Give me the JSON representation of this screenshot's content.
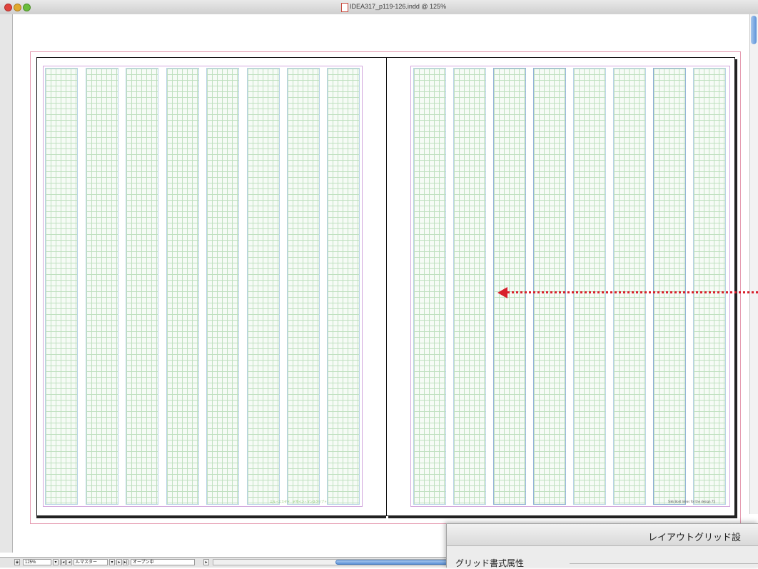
{
  "window": {
    "title": "IDEA317_p119-126.indd @ 125%"
  },
  "pages": {
    "left_folio": "エル・エスタド　デザイン・マンスクリプト",
    "right_folio": "Sikk Bold  Ideas for the design  75"
  },
  "statusbar": {
    "zoom": "125%",
    "page_field": "A-マスター",
    "status": "オープン中"
  },
  "dialog": {
    "title": "レイアウトグリッド設",
    "section_label": "グリッド書式属性"
  },
  "annotation": {
    "arrow_color": "#d8202c"
  },
  "colors": {
    "grid_cell": "#bfe0bf",
    "column_border": "#b8d2e6",
    "bleed": "#e59ab0",
    "margin": "#d2a6dd"
  }
}
